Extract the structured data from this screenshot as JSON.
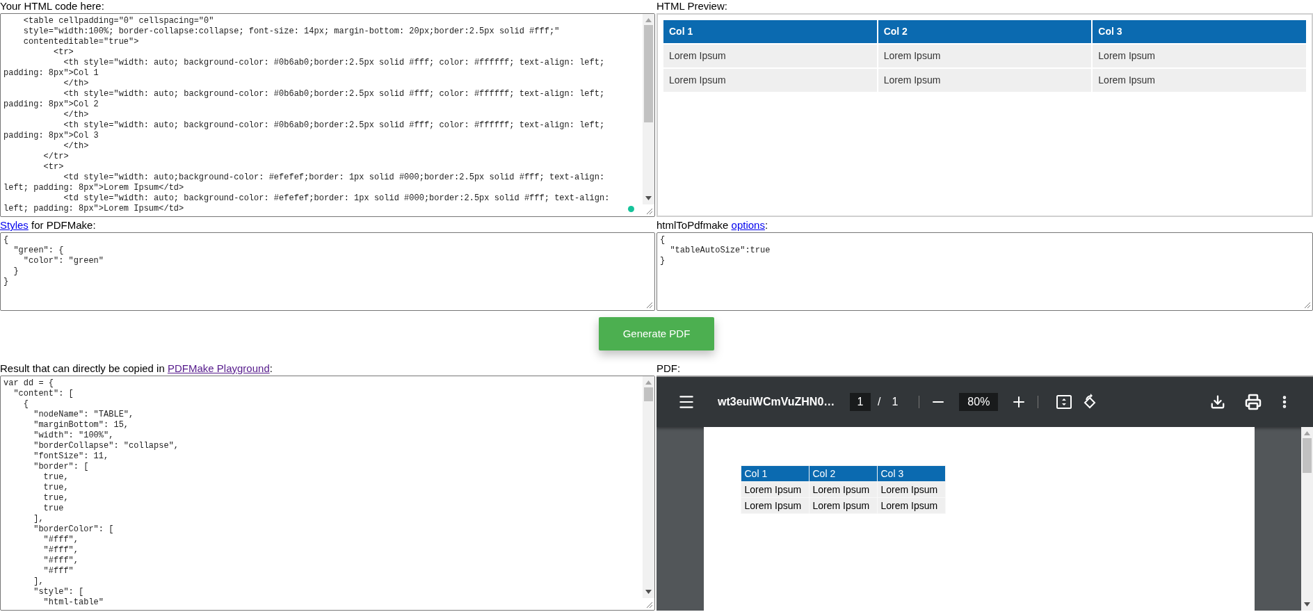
{
  "html_editor": {
    "label": "Your HTML code here:",
    "lines": [
      "    <table cellpadding=\"0\" cellspacing=\"0\"",
      "    style=\"width:100%; border-collapse:collapse; font-size: 14px; margin-bottom: 20px;border:2.5px solid #fff;\"",
      "    contenteditable=\"true\">",
      "          <tr>",
      "            <th style=\"width: auto; background-color: #0b6ab0;border:2.5px solid #fff; color: #ffffff; text-align: left;",
      "padding: 8px\">Col 1",
      "            </th>",
      "            <th style=\"width: auto; background-color: #0b6ab0;border:2.5px solid #fff; color: #ffffff; text-align: left;",
      "padding: 8px\">Col 2",
      "            </th>",
      "            <th style=\"width: auto; background-color: #0b6ab0;border:2.5px solid #fff; color: #ffffff; text-align: left;",
      "padding: 8px\">Col 3",
      "            </th>",
      "        </tr>",
      "        <tr>",
      "            <td style=\"width: auto;background-color: #efefef;border: 1px solid #000;border:2.5px solid #fff; text-align:",
      "left; padding: 8px\">Lorem Ipsum</td>",
      "            <td style=\"width: auto; background-color: #efefef;border: 1px solid #000;border:2.5px solid #fff; text-align:",
      "left; padding: 8px\">Lorem Ipsum</td>"
    ]
  },
  "preview": {
    "label": "HTML Preview:",
    "table": {
      "columns": [
        "Col 1",
        "Col 2",
        "Col 3"
      ],
      "rows": [
        [
          "Lorem Ipsum",
          "Lorem Ipsum",
          "Lorem Ipsum"
        ],
        [
          "Lorem Ipsum",
          "Lorem Ipsum",
          "Lorem Ipsum"
        ]
      ]
    }
  },
  "styles_editor": {
    "label_link": {
      "text": "Styles",
      "visited": false
    },
    "label_rest": "for PDFMake:",
    "lines": [
      "{",
      "  \"green\": {",
      "    \"color\": \"green\"",
      "  }",
      "}"
    ]
  },
  "options_editor": {
    "label_text": "htmlToPdfmake",
    "label_link": {
      "text": "options",
      "visited": false
    },
    "label_end": ":",
    "lines": [
      "{",
      "  \"tableAutoSize\":true",
      "}"
    ]
  },
  "generate_button": "Generate PDF",
  "result": {
    "label_text": "Result that can directly be copied in",
    "label_link": {
      "text": "PDFMake Playground",
      "visited": true
    },
    "label_end": ":",
    "lines": [
      "var dd = {",
      "  \"content\": [",
      "    {",
      "      \"nodeName\": \"TABLE\",",
      "      \"marginBottom\": 15,",
      "      \"width\": \"100%\",",
      "      \"borderCollapse\": \"collapse\",",
      "      \"fontSize\": 11,",
      "      \"border\": [",
      "        true,",
      "        true,",
      "        true,",
      "        true",
      "      ],",
      "      \"borderColor\": [",
      "        \"#fff\",",
      "        \"#fff\",",
      "        \"#fff\",",
      "        \"#fff\"",
      "      ],",
      "      \"style\": [",
      "        \"html-table\""
    ]
  },
  "pdf": {
    "label": "PDF:",
    "filename": "wt3euiWCmVuZHN0…",
    "page": "1",
    "page_separator": "/",
    "page_count": "1",
    "zoom": "80%",
    "table": {
      "columns": [
        "Col 1",
        "Col 2",
        "Col 3"
      ],
      "rows": [
        [
          "Lorem Ipsum",
          "Lorem Ipsum",
          "Lorem Ipsum"
        ],
        [
          "Lorem Ipsum",
          "Lorem Ipsum",
          "Lorem Ipsum"
        ]
      ]
    }
  }
}
